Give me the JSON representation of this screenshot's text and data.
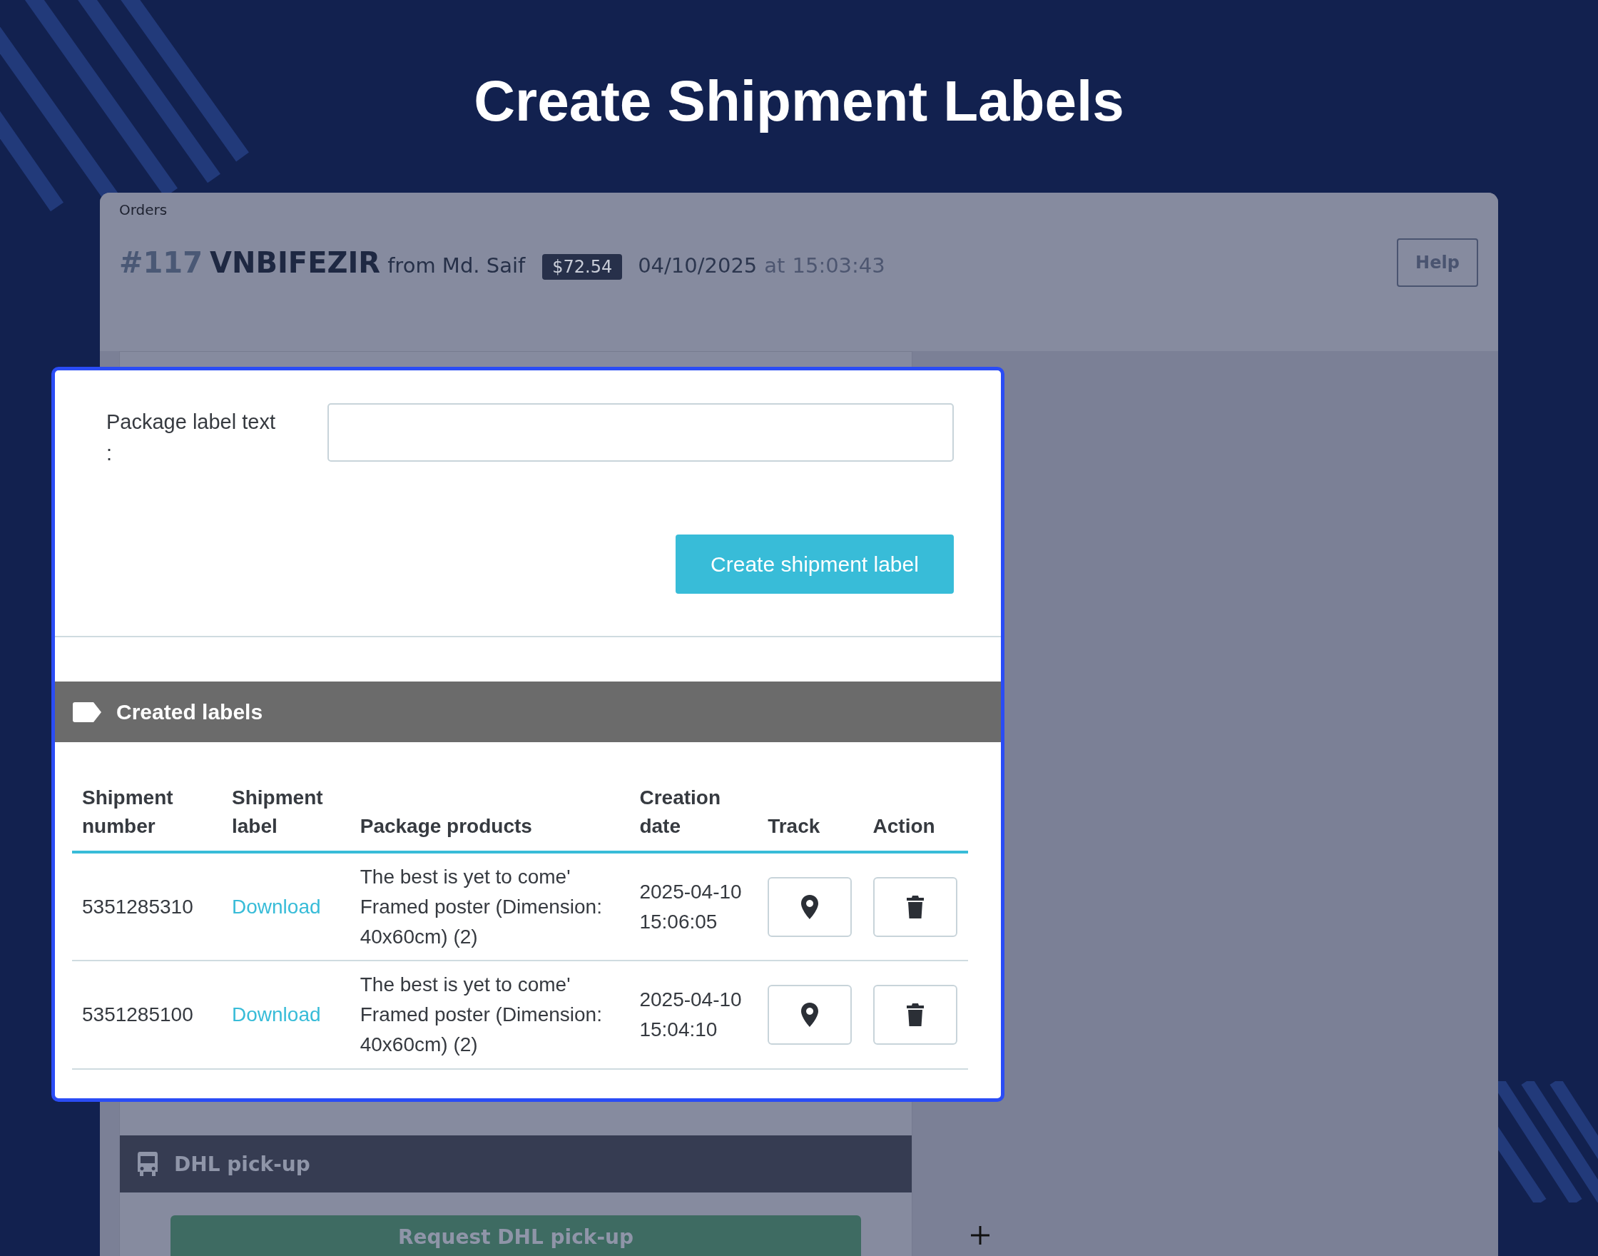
{
  "heading": "Create Shipment Labels",
  "breadcrumb": "Orders",
  "order": {
    "number": "#117",
    "reference": "VNBIFEZIR",
    "from": "from Md. Saif",
    "total": "$72.54",
    "date": "04/10/2025",
    "at": "at",
    "time": "15:03:43"
  },
  "help_button": "Help",
  "modal": {
    "field_label": "Package label text :",
    "create_button": "Create shipment label",
    "section_title": "Created labels",
    "table": {
      "columns": [
        "Shipment number",
        "Shipment label",
        "Package products",
        "Creation date",
        "Track",
        "Action"
      ],
      "rows": [
        {
          "shipment_number": "5351285310",
          "shipment_label": "Download",
          "package_products": "The best is yet to come' Framed poster (Dimension: 40x60cm) (2)",
          "creation_date": "2025-04-10 15:06:05"
        },
        {
          "shipment_number": "5351285100",
          "shipment_label": "Download",
          "package_products": "The best is yet to come' Framed poster (Dimension: 40x60cm) (2)",
          "creation_date": "2025-04-10 15:04:10"
        }
      ]
    }
  },
  "pickup": {
    "title": "DHL pick-up",
    "button": "Request DHL pick-up"
  }
}
